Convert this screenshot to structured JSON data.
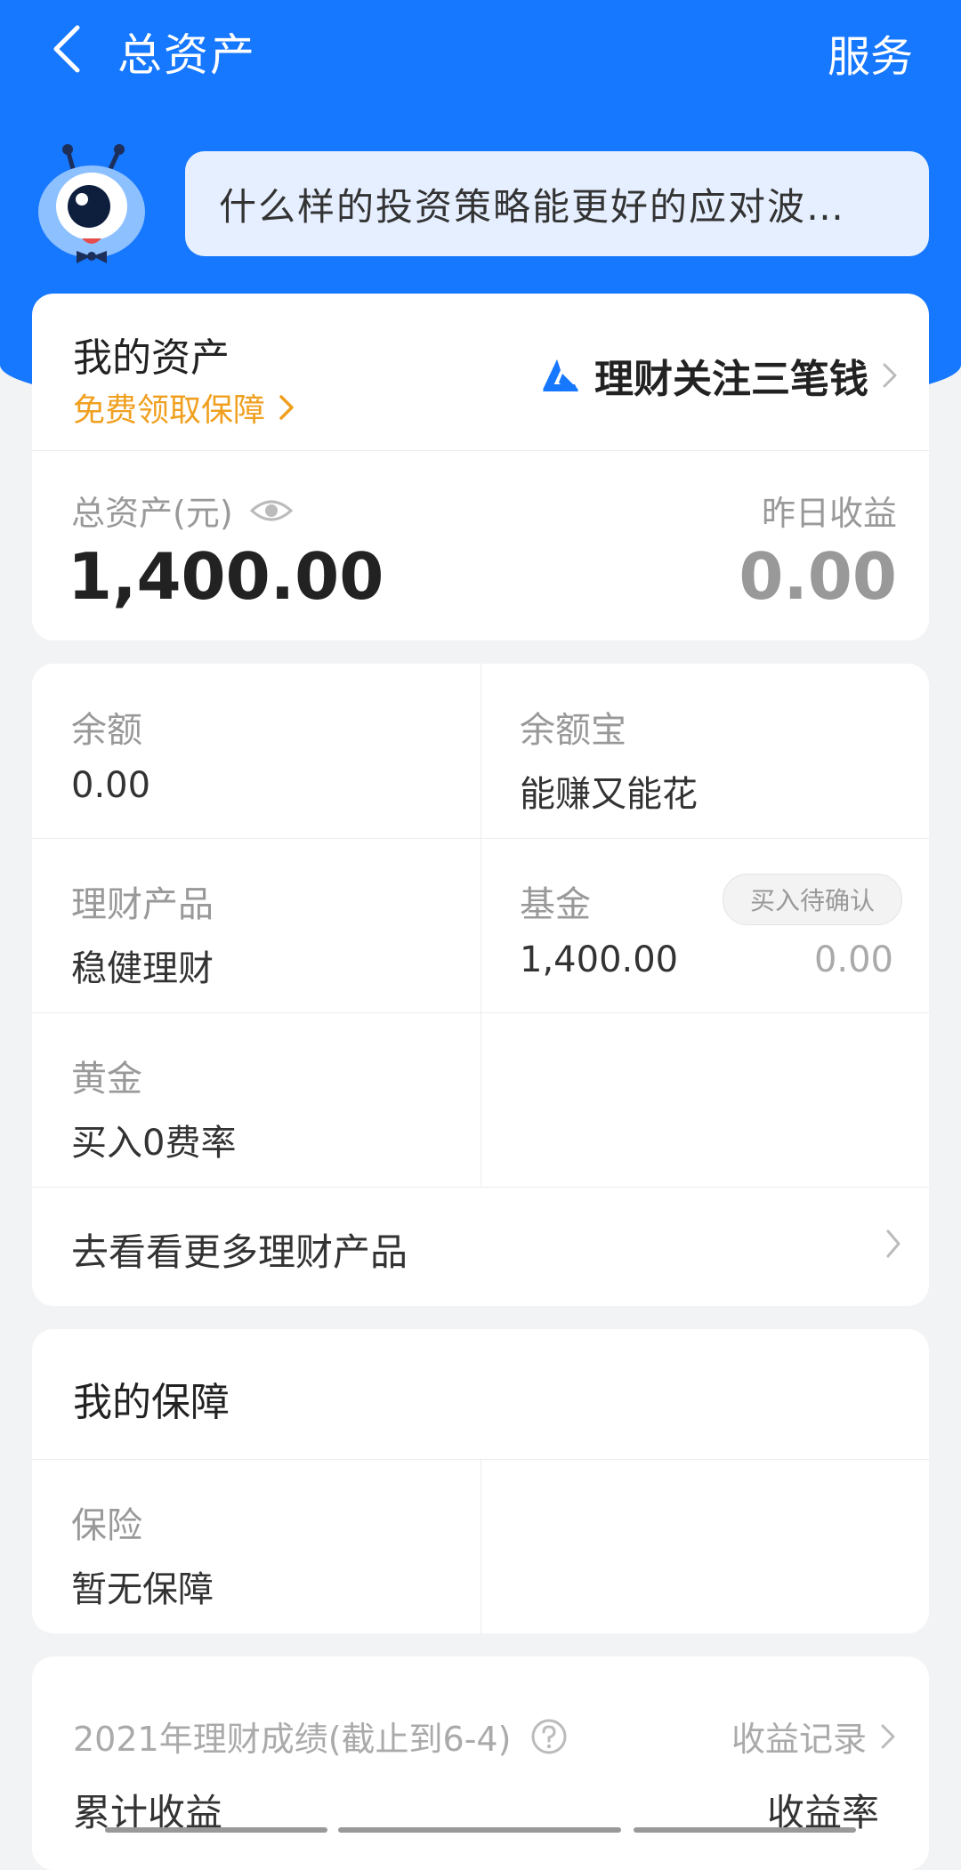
{
  "header": {
    "title": "总资产",
    "service_label": "服务",
    "bubble_text": "什么样的投资策略能更好的应对波…"
  },
  "assets_card": {
    "title": "我的资产",
    "protection_link": "免费领取保障",
    "focus_link": "理财关注三笔钱",
    "total_label": "总资产(元)",
    "total_value": "1,400.00",
    "yesterday_label": "昨日收益",
    "yesterday_value": "0.00"
  },
  "products": {
    "cells": [
      {
        "label": "余额",
        "value": "0.00"
      },
      {
        "label": "余额宝",
        "value": "能赚又能花"
      },
      {
        "label": "理财产品",
        "value": "稳健理财"
      },
      {
        "label": "基金",
        "value": "1,400.00"
      },
      {
        "label": "黄金",
        "value": "买入0费率"
      }
    ],
    "pending_badge": "买入待确认",
    "pending_value": "0.00",
    "more_label": "去看看更多理财产品"
  },
  "protection": {
    "title": "我的保障",
    "insurance_label": "保险",
    "insurance_value": "暂无保障"
  },
  "performance": {
    "label": "2021年理财成绩(截止到6-4)",
    "record_label": "收益记录",
    "cumulative_label": "累计收益",
    "rate_label": "收益率"
  },
  "colors": {
    "primary_blue": "#1677ff",
    "link_orange": "#f0a020",
    "muted_gray": "#999999"
  },
  "icons": {
    "back": "chevron-left-icon",
    "eye": "eye-icon",
    "chevron": "chevron-right-icon",
    "help": "question-circle-icon",
    "brand": "ant-fortune-logo"
  }
}
